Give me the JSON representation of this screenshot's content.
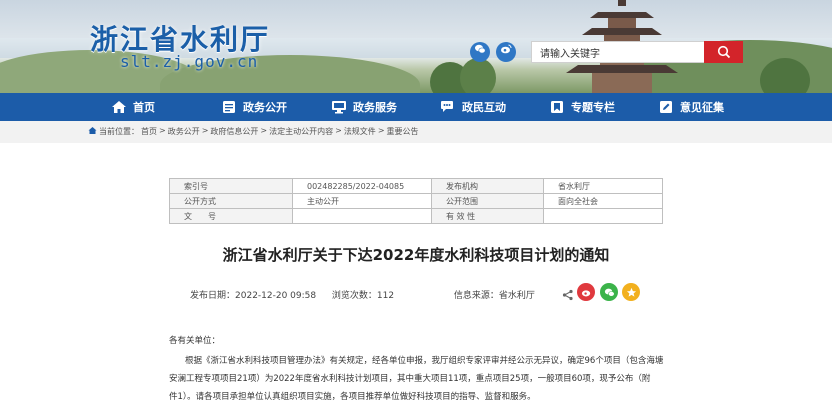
{
  "site": {
    "title": "浙江省水利厅",
    "domain": "slt.zj.gov.cn"
  },
  "search": {
    "placeholder": "请输入关键字"
  },
  "nav": {
    "items": [
      {
        "label": "首页",
        "icon": "home-icon"
      },
      {
        "label": "政务公开",
        "icon": "document-icon"
      },
      {
        "label": "政务服务",
        "icon": "monitor-icon"
      },
      {
        "label": "政民互动",
        "icon": "chat-icon"
      },
      {
        "label": "专题专栏",
        "icon": "bookmark-icon"
      },
      {
        "label": "意见征集",
        "icon": "edit-icon"
      }
    ]
  },
  "breadcrumb": {
    "prefix": "当前位置：",
    "items": [
      "首页",
      "政务公开",
      "政府信息公开",
      "法定主动公开内容",
      "法规文件",
      "重要公告"
    ],
    "separator": " > "
  },
  "meta": {
    "rows": [
      [
        "索引号",
        "002482285/2022-04085",
        "发布机构",
        "省水利厅"
      ],
      [
        "公开方式",
        "主动公开",
        "公开范围",
        "面向全社会"
      ],
      [
        "文　　号",
        "",
        "有 效 性",
        ""
      ]
    ]
  },
  "article": {
    "title": "浙江省水利厅关于下达2022年度水利科技项目计划的通知",
    "date_label": "发布日期：",
    "date": "2022-12-20 09:58",
    "views_label": "浏览次数：",
    "views": "112",
    "source_label": "信息来源：",
    "source": "省水利厅",
    "salutation": "各有关单位：",
    "para1_line1": "根据《浙江省水利科技项目管理办法》有关规定，经各单位申报，我厅组织专家评审并经公示无异议，确定96个项目（包含海塘",
    "para1_line2": "安澜工程专项项目21项）为2022年度省水利科技计划项目，其中重大项目11项，重点项目25项，一般项目60项，现予公布（附",
    "para1_line3": "件1）。请各项目承担单位认真组织项目实施，各项目推荐单位做好科技项目的指导、监督和服务。"
  },
  "colors": {
    "brand_blue": "#1c5ca9",
    "search_red": "#d3242a",
    "weibo": "#e0393e",
    "wechat": "#3bb34a",
    "qzone": "#f2b01e"
  }
}
